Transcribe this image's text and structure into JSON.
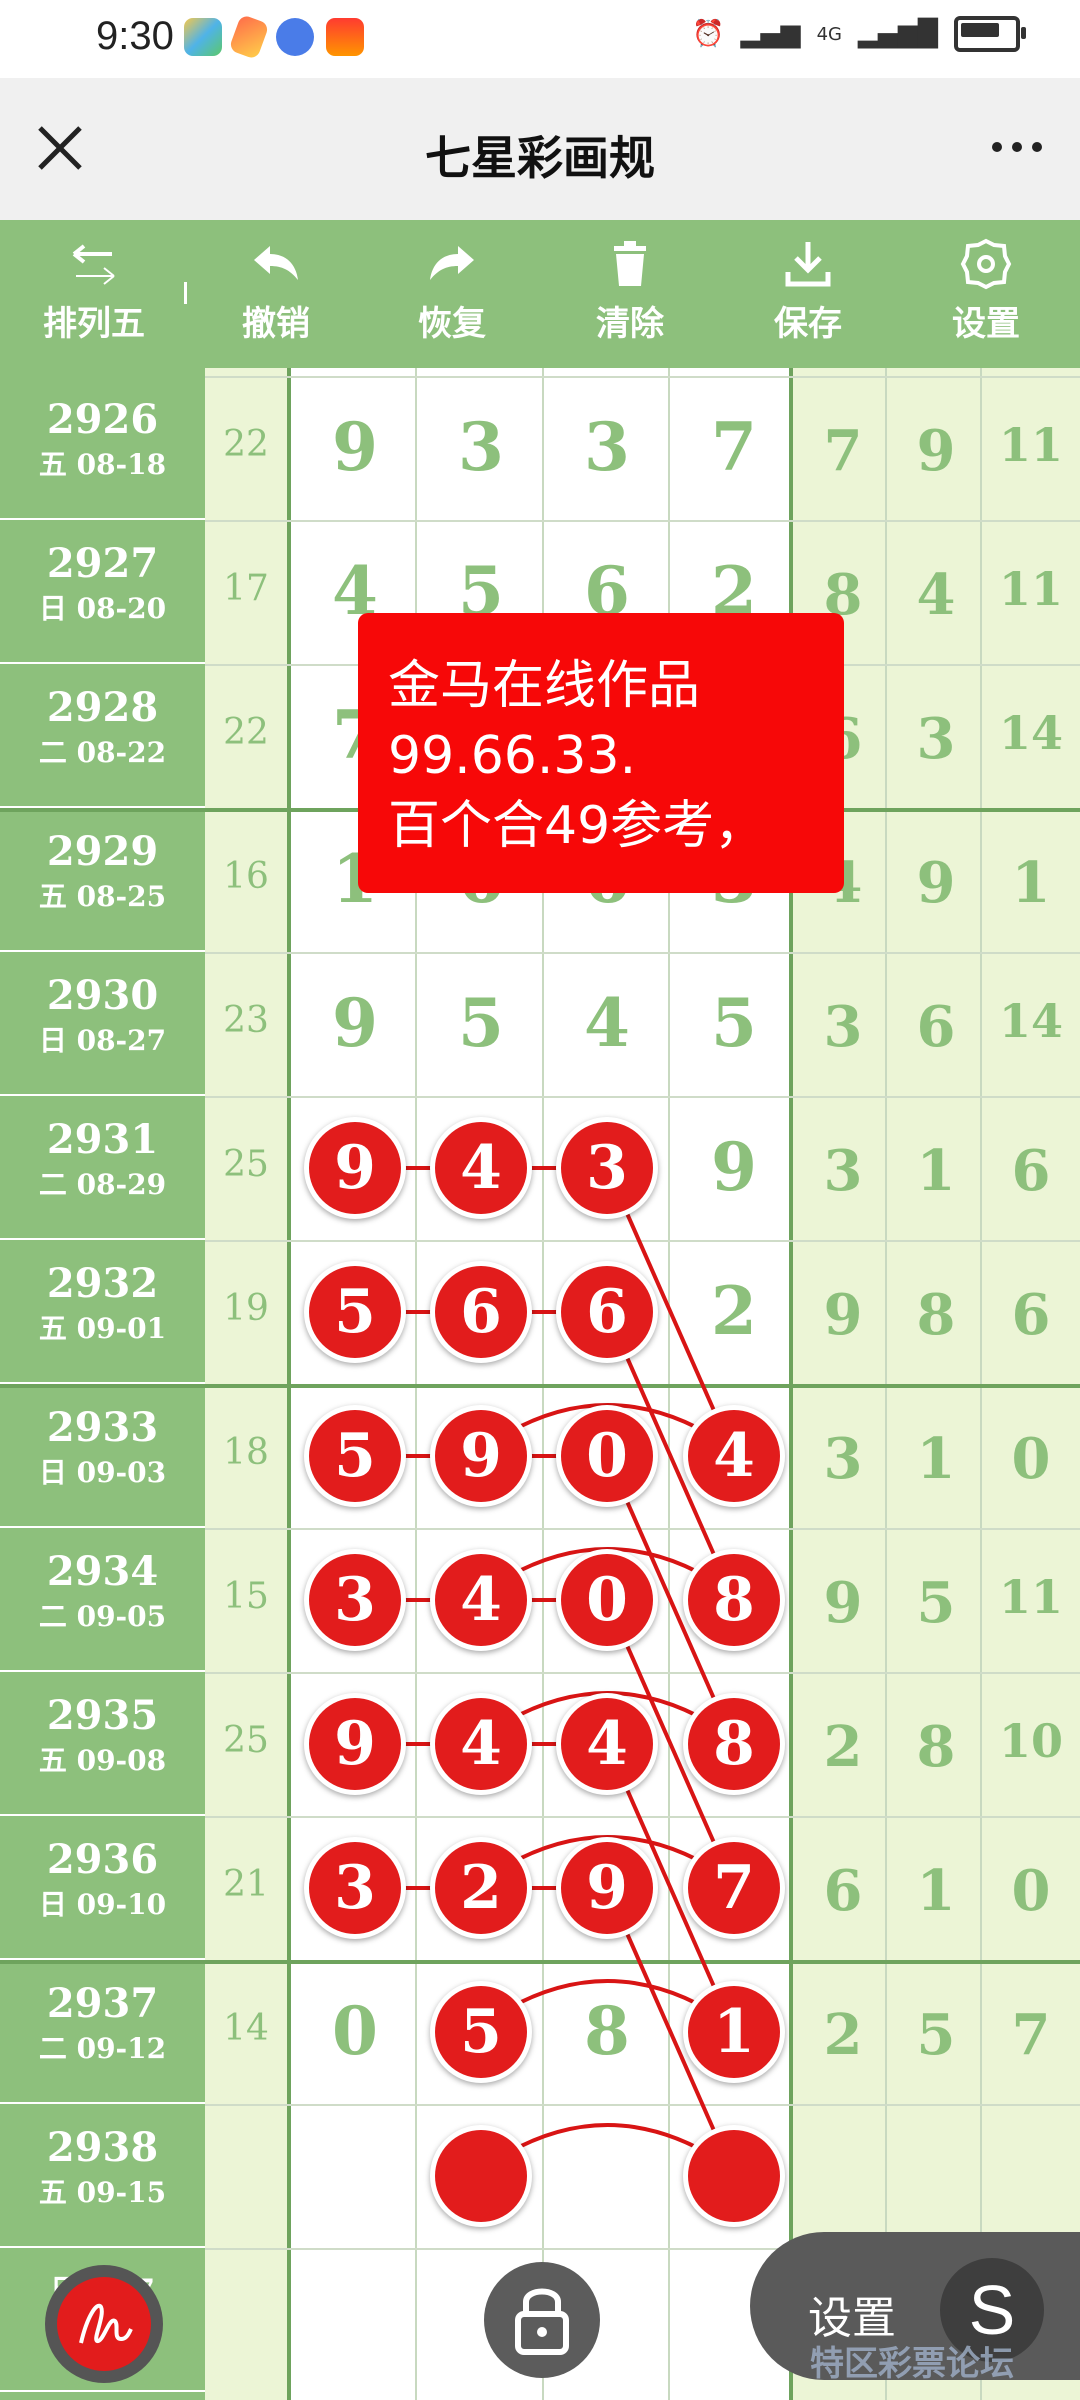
{
  "status": {
    "time": "9:30",
    "network": "4G"
  },
  "app": {
    "title": "七星彩画规"
  },
  "toolbar": {
    "items": [
      {
        "label": "排列五"
      },
      {
        "label": "撤销"
      },
      {
        "label": "恢复"
      },
      {
        "label": "清除"
      },
      {
        "label": "保存"
      },
      {
        "label": "设置"
      }
    ]
  },
  "rows": [
    {
      "issue": "2926",
      "date": "五 08-18",
      "sum": "22",
      "main": [
        "9",
        "3",
        "3",
        "7"
      ],
      "right": [
        "7",
        "9",
        "11"
      ]
    },
    {
      "issue": "2927",
      "date": "日 08-20",
      "sum": "17",
      "main": [
        "4",
        "5",
        "6",
        "2"
      ],
      "right": [
        "8",
        "4",
        "11"
      ]
    },
    {
      "issue": "2928",
      "date": "二 08-22",
      "sum": "22",
      "main": [
        "7",
        "",
        "",
        ""
      ],
      "right": [
        "6",
        "3",
        "14"
      ]
    },
    {
      "issue": "2929",
      "date": "五 08-25",
      "sum": "16",
      "main": [
        "1",
        "6",
        "6",
        "3"
      ],
      "right": [
        "4",
        "9",
        "1"
      ]
    },
    {
      "issue": "2930",
      "date": "日 08-27",
      "sum": "23",
      "main": [
        "9",
        "5",
        "4",
        "5"
      ],
      "right": [
        "3",
        "6",
        "14"
      ]
    },
    {
      "issue": "2931",
      "date": "二 08-29",
      "sum": "25",
      "main": [
        "9",
        "4",
        "3",
        "9"
      ],
      "right": [
        "3",
        "1",
        "6"
      ]
    },
    {
      "issue": "2932",
      "date": "五 09-01",
      "sum": "19",
      "main": [
        "5",
        "6",
        "6",
        "2"
      ],
      "right": [
        "9",
        "8",
        "6"
      ]
    },
    {
      "issue": "2933",
      "date": "日 09-03",
      "sum": "18",
      "main": [
        "5",
        "9",
        "0",
        "4"
      ],
      "right": [
        "3",
        "1",
        "0"
      ]
    },
    {
      "issue": "2934",
      "date": "二 09-05",
      "sum": "15",
      "main": [
        "3",
        "4",
        "0",
        "8"
      ],
      "right": [
        "9",
        "5",
        "11"
      ]
    },
    {
      "issue": "2935",
      "date": "五 09-08",
      "sum": "25",
      "main": [
        "9",
        "4",
        "4",
        "8"
      ],
      "right": [
        "2",
        "8",
        "10"
      ]
    },
    {
      "issue": "2936",
      "date": "日 09-10",
      "sum": "21",
      "main": [
        "3",
        "2",
        "9",
        "7"
      ],
      "right": [
        "6",
        "1",
        "0"
      ]
    },
    {
      "issue": "2937",
      "date": "二 09-12",
      "sum": "14",
      "main": [
        "0",
        "5",
        "8",
        "1"
      ],
      "right": [
        "2",
        "5",
        "7"
      ]
    },
    {
      "issue": "2938",
      "date": "五 09-15",
      "sum": "",
      "main": [
        "",
        "",
        "",
        ""
      ],
      "right": [
        "",
        "",
        ""
      ]
    },
    {
      "issue": "",
      "date": "日 …17",
      "sum": "",
      "main": [
        "",
        "",
        "",
        ""
      ],
      "right": [
        "",
        "",
        ""
      ]
    }
  ],
  "popup": {
    "line1": "金马在线作品",
    "line2": "99.66.33.",
    "line3": "百个合49参考，"
  },
  "bottom": {
    "settings_label": "设置",
    "s_glyph": "S",
    "watermark": "特区彩票论坛"
  },
  "colors": {
    "green": "#8dc07c",
    "light_green": "#ecf5d6",
    "ball_red": "#e21c1c",
    "popup_red": "#f70808"
  }
}
